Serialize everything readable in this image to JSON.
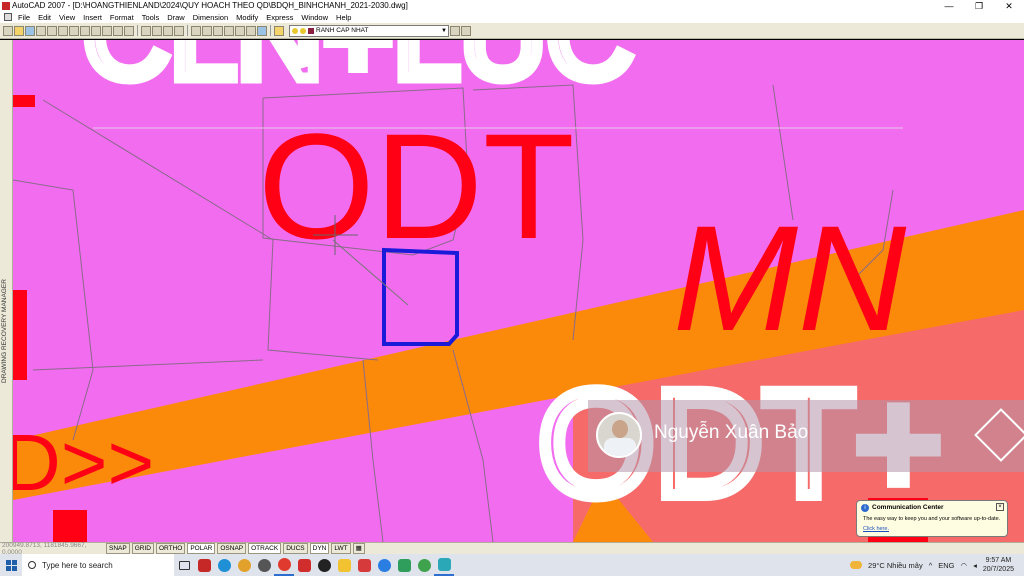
{
  "window": {
    "title": "AutoCAD 2007 - [D:\\HOANGTHIENLAND\\2024\\QUY HOACH THEO QD\\BDQH_BINHCHANH_2021-2030.dwg]",
    "minimize": "—",
    "restore": "❐",
    "close": "✕"
  },
  "menu": [
    "File",
    "Edit",
    "View",
    "Insert",
    "Format",
    "Tools",
    "Draw",
    "Dimension",
    "Modify",
    "Express",
    "Window",
    "Help"
  ],
  "toolbar": {
    "layer_name": "RANH CAP NHAT",
    "layer_color": "#8a2040"
  },
  "left_panel": {
    "label": "DRAWING RECOVERY MANAGER"
  },
  "map": {
    "pink": "#f26cf0",
    "orange": "#fb8a0b",
    "red": "#ff0014",
    "salmon": "#f66a6a",
    "labels": {
      "top_big": "CLN+LUC",
      "odt_top": "ODT",
      "mn": "MN",
      "odt_plus": "ODT+",
      "left_fragment": "D>>"
    }
  },
  "watermark": {
    "name": "Nguyễn Xuân Bảo"
  },
  "notification": {
    "title": "Communication Center",
    "body": "The easy way to keep you and your software up-to-date.",
    "link": "Click here."
  },
  "statusbar": {
    "coords": "200949.8713, 1181845.9667, 0.0000",
    "toggles": [
      "SNAP",
      "GRID",
      "ORTHO",
      "POLAR",
      "OSNAP",
      "OTRACK",
      "DUCS",
      "DYN",
      "LWT"
    ]
  },
  "taskbar": {
    "search_placeholder": "Type here to search",
    "weather": "29°C  Nhiều mây",
    "lang": "ENG",
    "time": "9:57 AM",
    "date": "20/7/2025"
  }
}
